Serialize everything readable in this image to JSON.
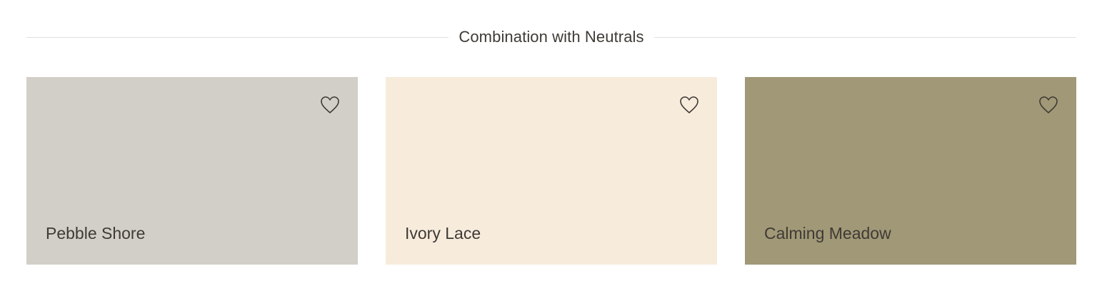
{
  "section": {
    "title": "Combination with Neutrals"
  },
  "cards": [
    {
      "name": "Pebble Shore",
      "color": "#d2cfc8",
      "favorite_icon": "heart-outline-icon"
    },
    {
      "name": "Ivory Lace",
      "color": "#f7ecdc",
      "favorite_icon": "heart-outline-icon"
    },
    {
      "name": "Calming Meadow",
      "color": "#a19877",
      "favorite_icon": "heart-outline-icon"
    }
  ],
  "colors": {
    "text": "#3f3a35",
    "rule": "#e2e0dd",
    "background": "#ffffff"
  }
}
